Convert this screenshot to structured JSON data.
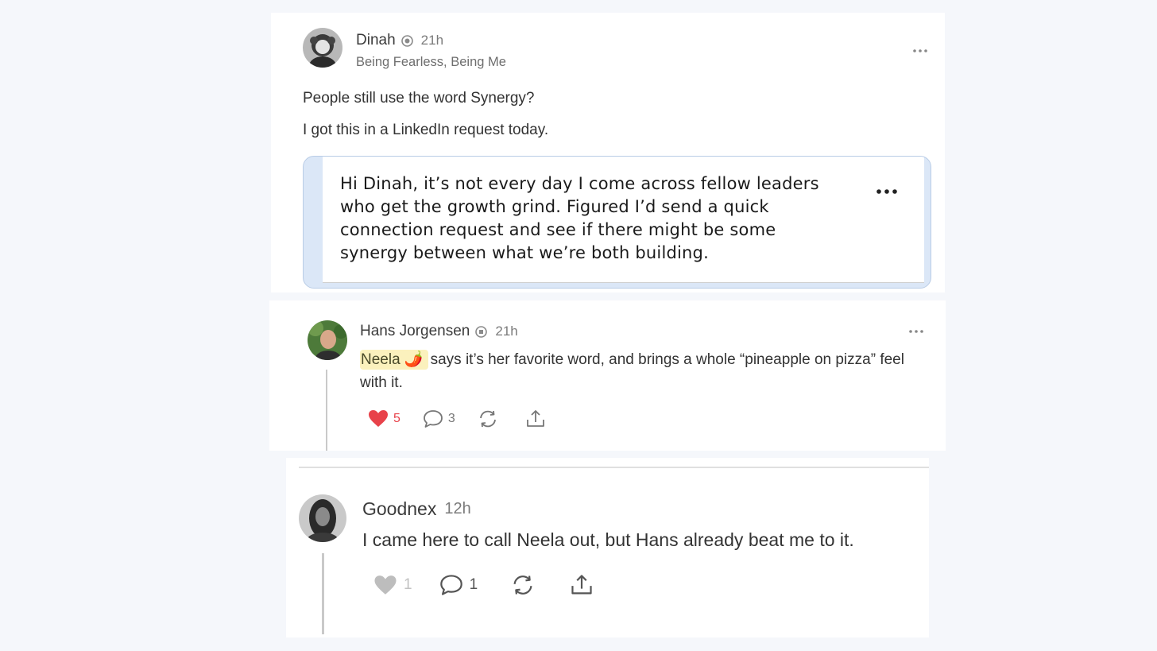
{
  "post": {
    "author": "Dinah",
    "time": "21h",
    "subtitle": "Being Fearless, Being Me",
    "text_lines": [
      "People still use the word Synergy?",
      "I got this in a LinkedIn request today."
    ],
    "embedded_message": "Hi Dinah, it’s not every day I come across fellow leaders who get the growth grind. Figured I’d send a quick connection request and see if there might be some synergy between what we’re both building.",
    "icons": {
      "badge": "verified-badge-icon",
      "more": "more-options-icon"
    }
  },
  "comment1": {
    "author": "Hans Jorgensen",
    "time": "21h",
    "mention": "Neela 🌶️",
    "text": "says it’s her favorite word, and brings a whole “pineapple on pizza” feel with it.",
    "likes": "5",
    "replies": "3",
    "liked": true,
    "icons": [
      "heart-icon",
      "comment-icon",
      "restack-icon",
      "share-icon"
    ]
  },
  "comment2": {
    "author": "Goodnex",
    "time": "12h",
    "text": "I came here to call Neela out, but Hans already beat me to it.",
    "likes": "1",
    "replies": "1",
    "liked": false
  },
  "colors": {
    "page_bg": "#f5f7fb",
    "liked_heart": "#e8424a",
    "unliked_heart": "#bdbdbd",
    "mention_bg": "#fbf1bd",
    "embed_border": "#b9cce6"
  }
}
